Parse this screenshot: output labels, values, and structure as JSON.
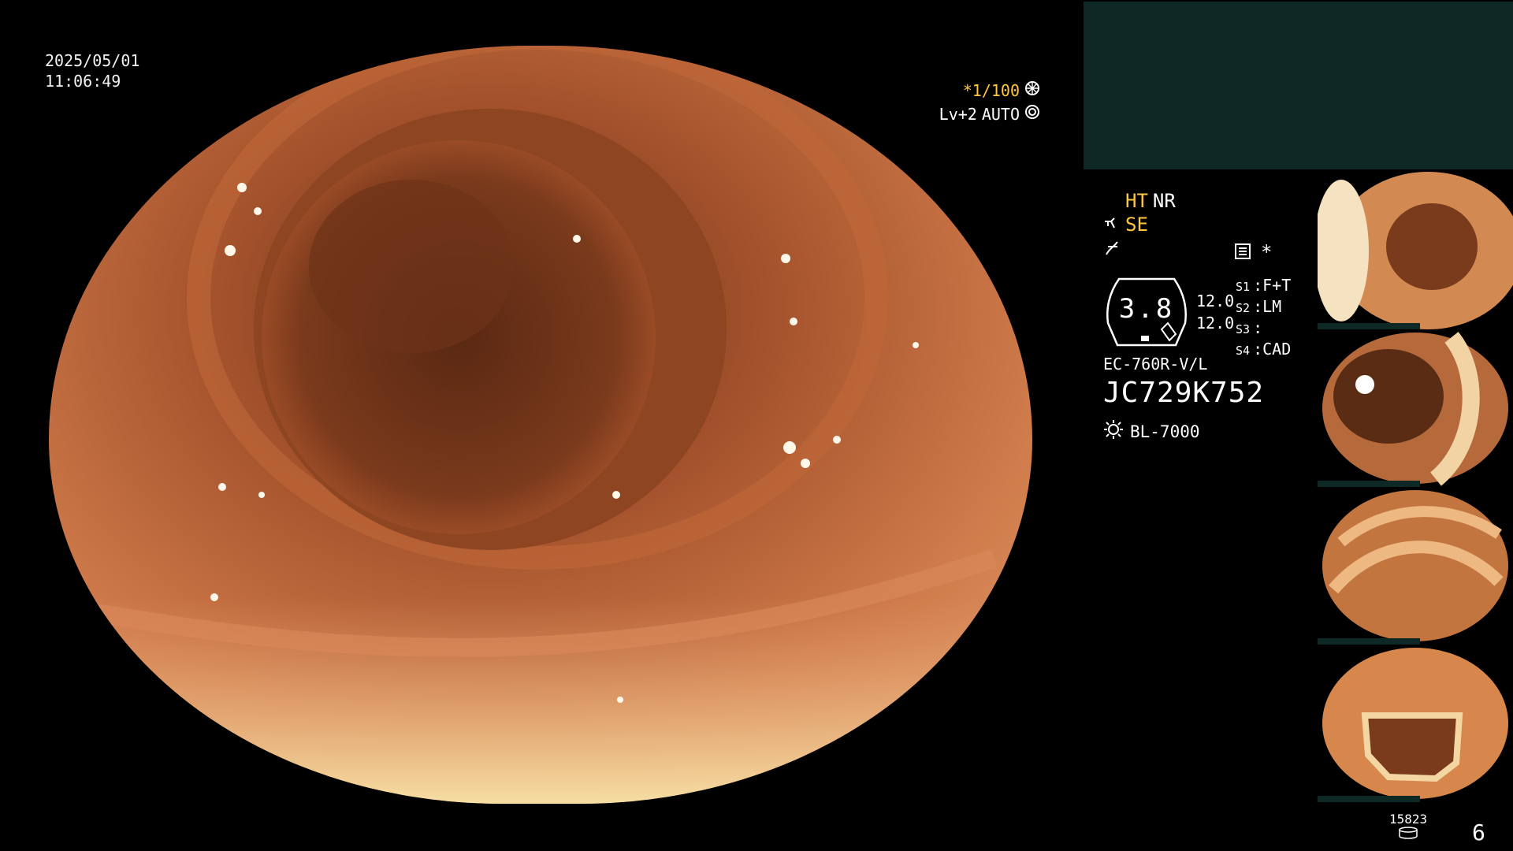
{
  "overlay": {
    "date": "2025/05/01",
    "time": "11:06:49",
    "shutter": "*1/100",
    "level": "Lv+2",
    "mode": "AUTO"
  },
  "status": {
    "ht": "HT",
    "nr": "NR",
    "se": "SE",
    "zoom": "3.8",
    "param1": "12.0",
    "param2": "12.0",
    "star": "*"
  },
  "scope_buttons": [
    {
      "label": "S1",
      "value": "F+T"
    },
    {
      "label": "S2",
      "value": "LM"
    },
    {
      "label": "S3",
      "value": ""
    },
    {
      "label": "S4",
      "value": "CAD"
    }
  ],
  "device": {
    "model": "EC-760R-V/L",
    "serial": "JC729K752",
    "light_source": "BL-7000"
  },
  "footer": {
    "image_count": "15823",
    "page": "6"
  },
  "colors": {
    "accent": "#ffc640",
    "panel": "#0e2825",
    "mucosa": "#b5643a"
  },
  "icons": [
    "shutter-icon",
    "auto-iris-icon",
    "scope-icon",
    "freeze-icon",
    "settings-icon",
    "light-icon",
    "storage-icon"
  ]
}
